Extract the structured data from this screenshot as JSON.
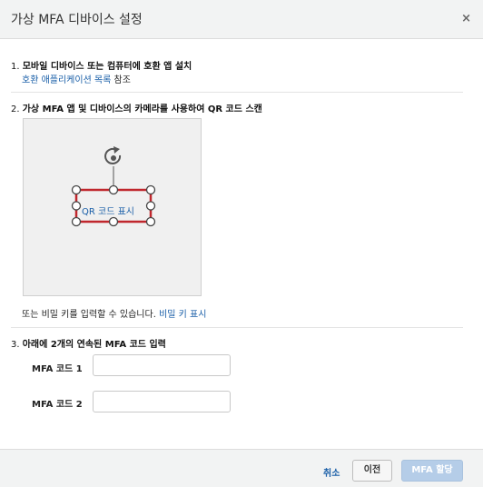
{
  "dialog": {
    "title": "가상 MFA 디바이스 설정",
    "close_symbol": "×"
  },
  "step1": {
    "number": "1.",
    "text": "모바일 디바이스 또는 컴퓨터에 호환 앱 설치",
    "link": "호환 애플리케이션 목록",
    "suffix": " 참조"
  },
  "step2": {
    "number": "2.",
    "text": "가상 MFA 앱 및 디바이스의 카메라를 사용하여 QR 코드 스캔",
    "qr_link": "QR 코드 표시",
    "secret_text": "또는 비밀 키를 입력할 수 있습니다. ",
    "secret_link": "비밀 키 표시"
  },
  "step3": {
    "number": "3.",
    "text": "아래에 2개의 연속된 MFA 코드 입력",
    "code1_label": "MFA 코드 1",
    "code1_value": "",
    "code2_label": "MFA 코드 2",
    "code2_value": ""
  },
  "footer": {
    "cancel": "취소",
    "previous": "이전",
    "assign": "MFA 할당"
  },
  "colors": {
    "link": "#1a5fa8",
    "qr_frame": "#c0272d",
    "assign_button": "#b5cde8"
  },
  "icons": {
    "rotate": "rotate-icon",
    "close": "close-icon"
  }
}
